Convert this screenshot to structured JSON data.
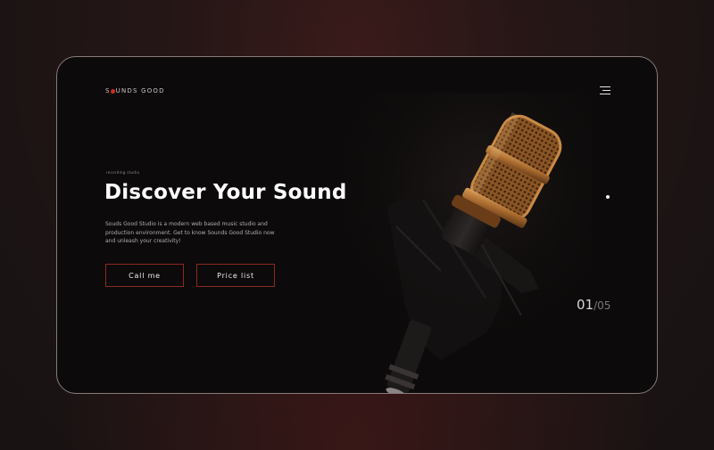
{
  "logo": {
    "prefix": "S",
    "suffix": "UNDS GOOD"
  },
  "hero": {
    "kicker": "recording studio",
    "title": "Discover Your Sound",
    "description": "Souds Good Studio is a modern web based music studio and production environment. Get to know Sounds Good Studio now and unleash your creativity!"
  },
  "buttons": {
    "call": "Call me",
    "price": "Price list"
  },
  "slider": {
    "current": "01",
    "total": "/05"
  },
  "colors": {
    "accent": "#d4291f",
    "button_border": "#8c2a22",
    "mic_gold": "#b07a3c"
  },
  "icons": {
    "menu": "hamburger-menu-icon",
    "logo_dot": "red-dot-icon"
  }
}
